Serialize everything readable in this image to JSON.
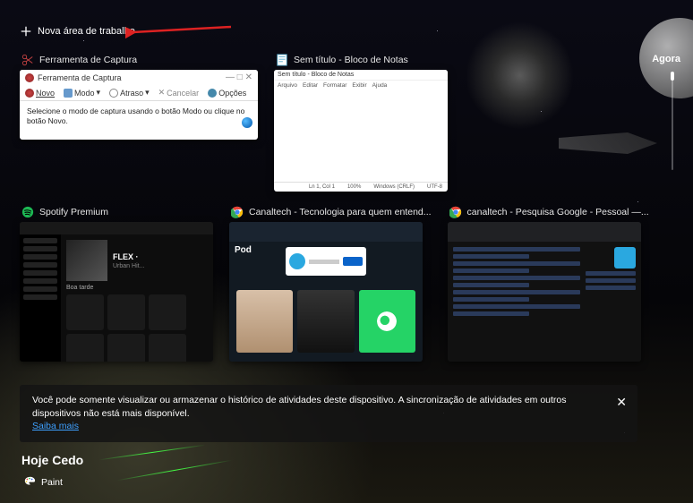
{
  "header": {
    "new_desktop": "Nova área de trabalho",
    "timeline_now": "Agora"
  },
  "row1": [
    {
      "title": "Ferramenta de Captura"
    },
    {
      "title": "Sem título - Bloco de Notas"
    }
  ],
  "snip": {
    "window_title": "Ferramenta de Captura",
    "toolbar": {
      "novo": "Novo",
      "modo": "Modo",
      "atraso": "Atraso",
      "cancelar": "Cancelar",
      "opcoes": "Opções"
    },
    "body": "Selecione o modo de captura usando o botão Modo ou clique no botão Novo."
  },
  "notepad": {
    "menu": [
      "Arquivo",
      "Editar",
      "Formatar",
      "Exibir",
      "Ajuda"
    ],
    "status": {
      "ln": "Ln 1, Col 1",
      "zoom": "100%",
      "os": "Windows (CRLF)",
      "enc": "UTF-8"
    }
  },
  "row2": [
    {
      "title": "Spotify Premium"
    },
    {
      "title": "Canaltech - Tecnologia para quem entend..."
    },
    {
      "title": "canaltech - Pesquisa Google - Pessoal —..."
    }
  ],
  "spotify": {
    "track_title": "FLEX ·",
    "track_sub": "Urban Hit...",
    "greeting": "Boa tarde"
  },
  "banner": {
    "text": "Você pode somente visualizar ou armazenar o histórico de atividades deste dispositivo. A sincronização de atividades em outros dispositivos não está mais disponível.",
    "link": "Saiba mais"
  },
  "earlier": {
    "heading": "Hoje Cedo",
    "items": [
      {
        "label": "Paint"
      }
    ]
  }
}
